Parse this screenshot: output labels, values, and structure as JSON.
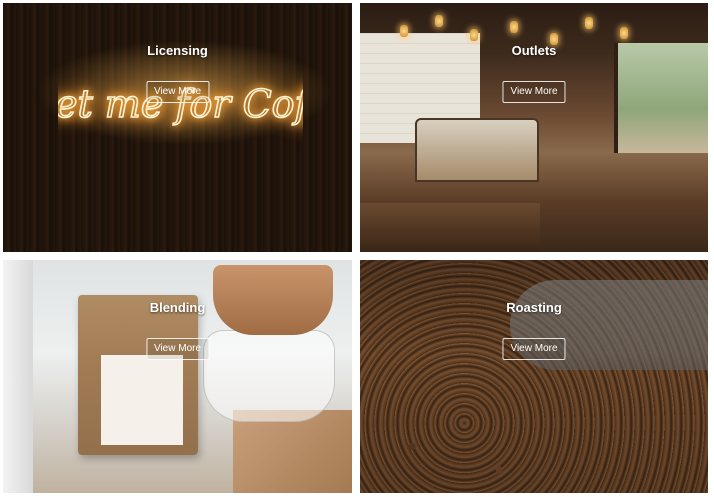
{
  "tiles": [
    {
      "title": "Licensing",
      "button": "View More"
    },
    {
      "title": "Outlets",
      "button": "View More"
    },
    {
      "title": "Blending",
      "button": "View More"
    },
    {
      "title": "Roasting",
      "button": "View More"
    }
  ],
  "neon_sign": {
    "text": "Meet me for Coffee",
    "color": "#ffd27a"
  }
}
